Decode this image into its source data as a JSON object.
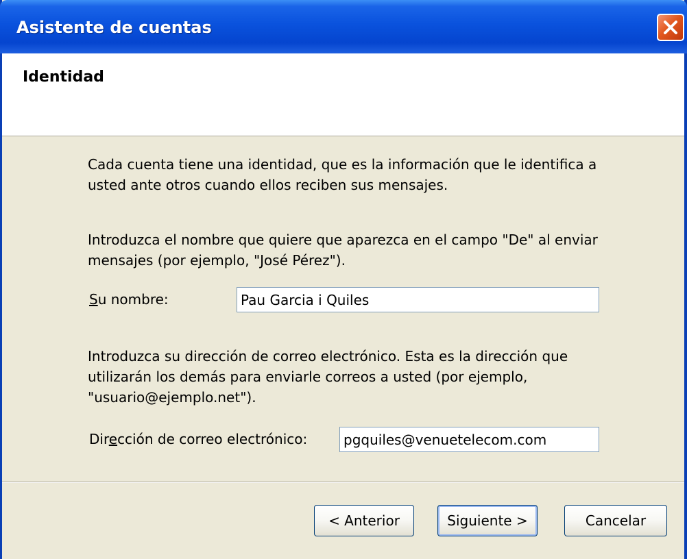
{
  "window": {
    "title": "Asistente de cuentas"
  },
  "header": {
    "title": "Identidad"
  },
  "content": {
    "intro": "Cada cuenta tiene una identidad, que es la información que le identifica a usted ante otros cuando ellos reciben sus mensajes.",
    "name_instructions": "Introduzca el nombre que quiere que aparezca en el campo \"De\" al enviar mensajes (por ejemplo, \"José Pérez\").",
    "name_label_accel": "S",
    "name_label_rest": "u nombre:",
    "name_value": "Pau Garcia i Quiles",
    "email_instructions": "Introduzca su dirección de correo electrónico. Esta es la dirección que utilizarán los demás para enviarle correos a usted (por ejemplo, \"usuario@ejemplo.net\").",
    "email_label_pre": "Dir",
    "email_label_accel": "e",
    "email_label_post": "cción de correo electrónico:",
    "email_value": "pgquiles@venuetelecom.com"
  },
  "buttons": {
    "back": "< Anterior",
    "next": "Siguiente >",
    "cancel": "Cancelar"
  }
}
